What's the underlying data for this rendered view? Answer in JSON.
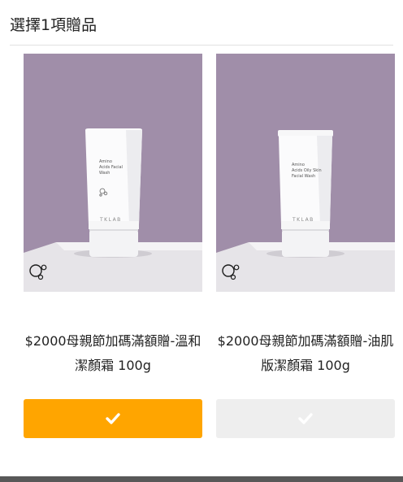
{
  "header": {
    "title": "選擇1項贈品"
  },
  "products": [
    {
      "name": "$2000母親節加碼滿額贈-溫和潔顏霜 100g",
      "tube_text": [
        "Amino",
        "Acids Facial",
        "Wash"
      ],
      "brand": "TKLAB",
      "selected": true,
      "button_color": "#ffa500"
    },
    {
      "name": "$2000母親節加碼滿額贈-油肌版潔顏霜 100g",
      "tube_text": [
        "Amino",
        "Acids Oily Skin",
        "Facial Wash"
      ],
      "brand": "TKLAB",
      "selected": false,
      "button_color": "#eeeeee"
    }
  ],
  "colors": {
    "accent": "#ffa500",
    "image_background": "#a08ea9",
    "divider": "#e2e2e2"
  },
  "icons": {
    "select_button": "check-icon",
    "image_logo": "bubble-logo-icon"
  }
}
